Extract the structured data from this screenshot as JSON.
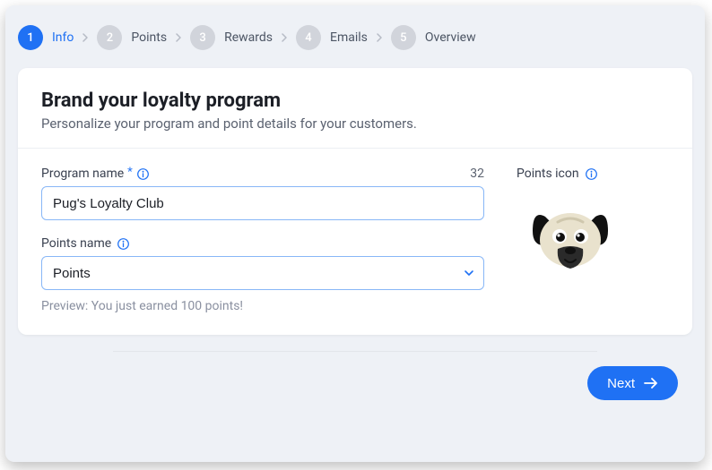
{
  "stepper": {
    "steps": [
      {
        "num": "1",
        "label": "Info",
        "active": true
      },
      {
        "num": "2",
        "label": "Points",
        "active": false
      },
      {
        "num": "3",
        "label": "Rewards",
        "active": false
      },
      {
        "num": "4",
        "label": "Emails",
        "active": false
      },
      {
        "num": "5",
        "label": "Overview",
        "active": false
      }
    ]
  },
  "card": {
    "title": "Brand your loyalty program",
    "subtitle": "Personalize your program and point details for your customers."
  },
  "form": {
    "program_name_label": "Program name",
    "program_name_required": "*",
    "program_name_counter": "32",
    "program_name_value": "Pug's Loyalty Club",
    "points_name_label": "Points name",
    "points_name_value": "Points",
    "preview_text": "Preview: You just earned 100 points!",
    "points_icon_label": "Points icon"
  },
  "footer": {
    "next_label": "Next"
  }
}
